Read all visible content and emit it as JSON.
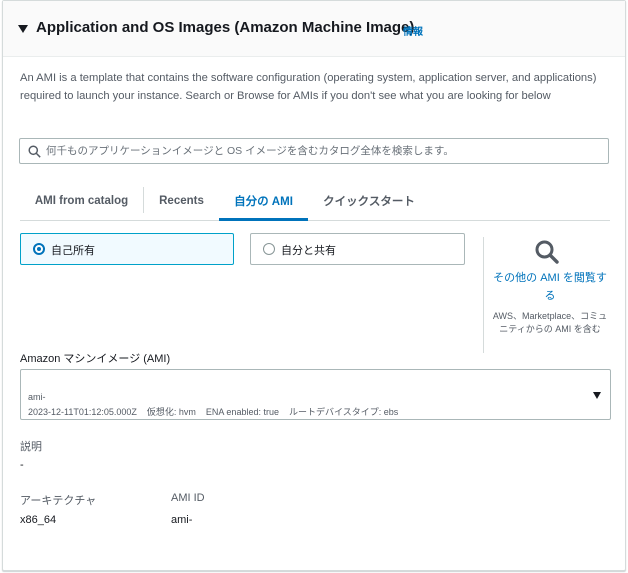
{
  "section": {
    "title": "Application and OS Images (Amazon Machine Image)",
    "info_link": "情報",
    "description": "An AMI is a template that contains the software configuration (operating system, application server, and applications) required to launch your instance. Search or Browse for AMIs if you don't see what you are looking for below"
  },
  "search": {
    "placeholder": "何千ものアプリケーションイメージと OS イメージを含むカタログ全体を検索します。",
    "value": ""
  },
  "tabs": [
    {
      "label": "AMI from catalog",
      "active": false
    },
    {
      "label": "Recents",
      "active": false
    },
    {
      "label": "自分の AMI",
      "active": true
    },
    {
      "label": "クイックスタート",
      "active": false
    }
  ],
  "ownership": {
    "options": [
      {
        "label": "自己所有",
        "selected": true
      },
      {
        "label": "自分と共有",
        "selected": false
      }
    ]
  },
  "browse": {
    "link": "その他の AMI を閲覧する",
    "note": "AWS、Marketplace、コミュニティからの AMI を含む"
  },
  "ami": {
    "label": "Amazon マシンイメージ (AMI)",
    "name": "ami-",
    "meta": "2023-12-11T01:12:05.000Z    仮想化: hvm    ENA enabled: true    ルートデバイスタイプ: ebs"
  },
  "details": {
    "description_label": "説明",
    "description_value": "-",
    "architecture_label": "アーキテクチャ",
    "architecture_value": "x86_64",
    "ami_id_label": "AMI ID",
    "ami_id_value": "ami-"
  },
  "colors": {
    "link": "#0073bb",
    "selected_border": "#00a1c9",
    "selected_bg": "#f1faff",
    "text": "#16191f",
    "muted": "#545b64"
  },
  "icons": {
    "section_toggle": "caret-down-icon",
    "search": "search-icon",
    "browse": "magnifier-icon",
    "select": "caret-down-icon"
  }
}
